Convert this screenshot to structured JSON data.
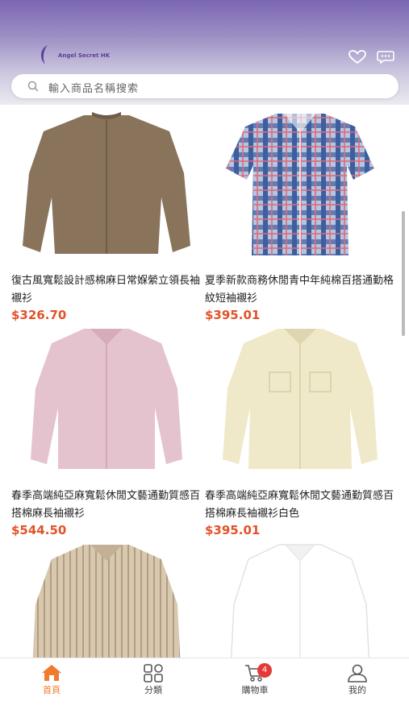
{
  "brand": {
    "name": "Angel Secret HK"
  },
  "colors": {
    "accent": "#f07a2d",
    "price": "#e2532a",
    "badge": "#e53935",
    "header_top": "#7b66b3"
  },
  "header": {
    "icons": [
      "heart-icon",
      "chat-icon"
    ]
  },
  "search": {
    "placeholder": "輸入商品名稱搜索"
  },
  "products": [
    {
      "title": "復古風寬鬆設計感棉麻日常媬縈立領長袖襯衫",
      "price": "$326.70"
    },
    {
      "title": "夏季新款商務休閒青中年純棉百搭通勤格紋短袖襯衫",
      "price": "$395.01"
    },
    {
      "title": "春季高端純亞麻寬鬆休閒文藝通勤質感百搭棉麻長袖襯衫",
      "price": "$544.50"
    },
    {
      "title": "春季高端純亞麻寬鬆休閒文藝通勤質感百搭棉麻長袖襯衫白色",
      "price": "$395.01"
    },
    {
      "title": "",
      "price": ""
    },
    {
      "title": "",
      "price": ""
    }
  ],
  "tabbar": {
    "items": [
      {
        "label": "首頁",
        "icon": "home-icon"
      },
      {
        "label": "分類",
        "icon": "grid-icon"
      },
      {
        "label": "購物車",
        "icon": "cart-icon",
        "badge": "4"
      },
      {
        "label": "我的",
        "icon": "user-icon"
      }
    ]
  }
}
